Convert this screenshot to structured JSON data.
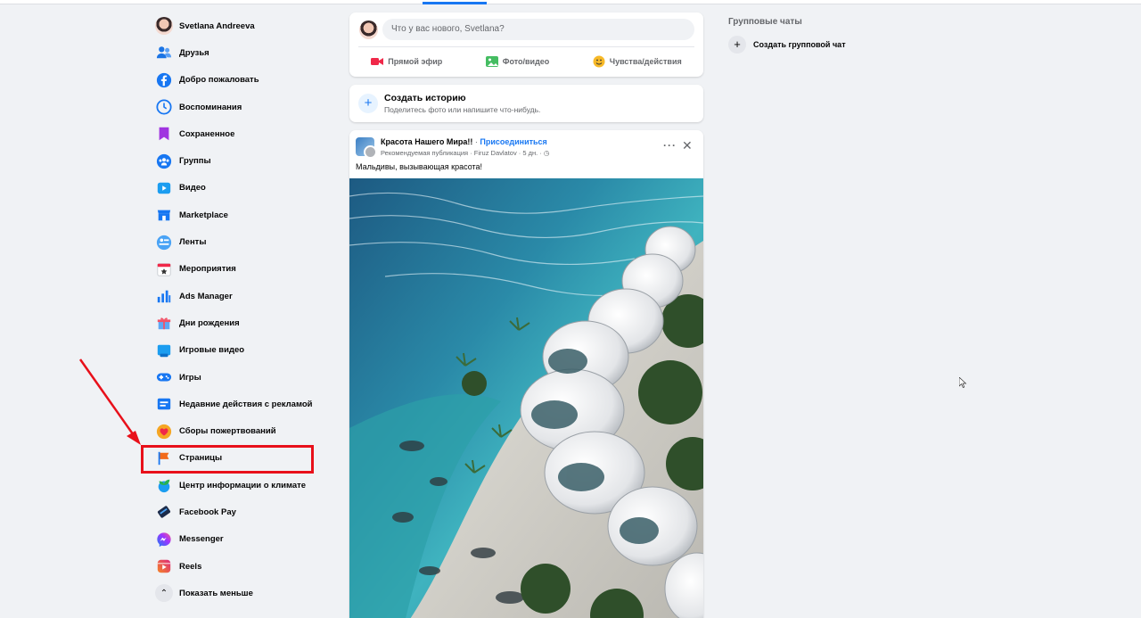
{
  "sidebar": {
    "items": [
      {
        "label": "Svetlana Andreeva",
        "icon": "avatar"
      },
      {
        "label": "Друзья",
        "icon": "friends-icon"
      },
      {
        "label": "Добро пожаловать",
        "icon": "facebook-icon"
      },
      {
        "label": "Воспоминания",
        "icon": "clock-icon"
      },
      {
        "label": "Сохраненное",
        "icon": "bookmark-icon"
      },
      {
        "label": "Группы",
        "icon": "groups-icon"
      },
      {
        "label": "Видео",
        "icon": "video-icon"
      },
      {
        "label": "Marketplace",
        "icon": "marketplace-icon"
      },
      {
        "label": "Ленты",
        "icon": "feeds-icon"
      },
      {
        "label": "Мероприятия",
        "icon": "calendar-icon"
      },
      {
        "label": "Ads Manager",
        "icon": "ads-chart-icon"
      },
      {
        "label": "Дни рождения",
        "icon": "gift-icon"
      },
      {
        "label": "Игровые видео",
        "icon": "gaming-video-icon"
      },
      {
        "label": "Игры",
        "icon": "gamepad-icon"
      },
      {
        "label": "Недавние действия с рекламой",
        "icon": "ad-activity-icon"
      },
      {
        "label": "Сборы пожертвований",
        "icon": "fundraiser-heart-icon"
      },
      {
        "label": "Страницы",
        "icon": "flag-icon"
      },
      {
        "label": "Центр информации о климате",
        "icon": "climate-icon"
      },
      {
        "label": "Facebook Pay",
        "icon": "pay-icon"
      },
      {
        "label": "Messenger",
        "icon": "messenger-icon"
      },
      {
        "label": "Reels",
        "icon": "reels-icon"
      },
      {
        "label": "Показать меньше",
        "icon": "chevron-up-icon"
      }
    ]
  },
  "composer": {
    "placeholder": "Что у вас нового, Svetlana?",
    "live": "Прямой эфир",
    "photo": "Фото/видео",
    "feeling": "Чувства/действия"
  },
  "story": {
    "title": "Создать историю",
    "subtitle": "Поделитесь фото или напишите что-нибудь."
  },
  "post": {
    "page_name": "Красота Нашего Мира!!",
    "separator": "·",
    "join": "Присоединиться",
    "meta": "Рекомендуемая публикация · Firuz Davlatov · 5 дн. ·",
    "caption": "Мальдивы, вызывающая красота!"
  },
  "right": {
    "title": "Групповые чаты",
    "create": "Создать групповой чат"
  },
  "colors": {
    "accent": "#1877f2",
    "highlight": "#e8101a"
  }
}
